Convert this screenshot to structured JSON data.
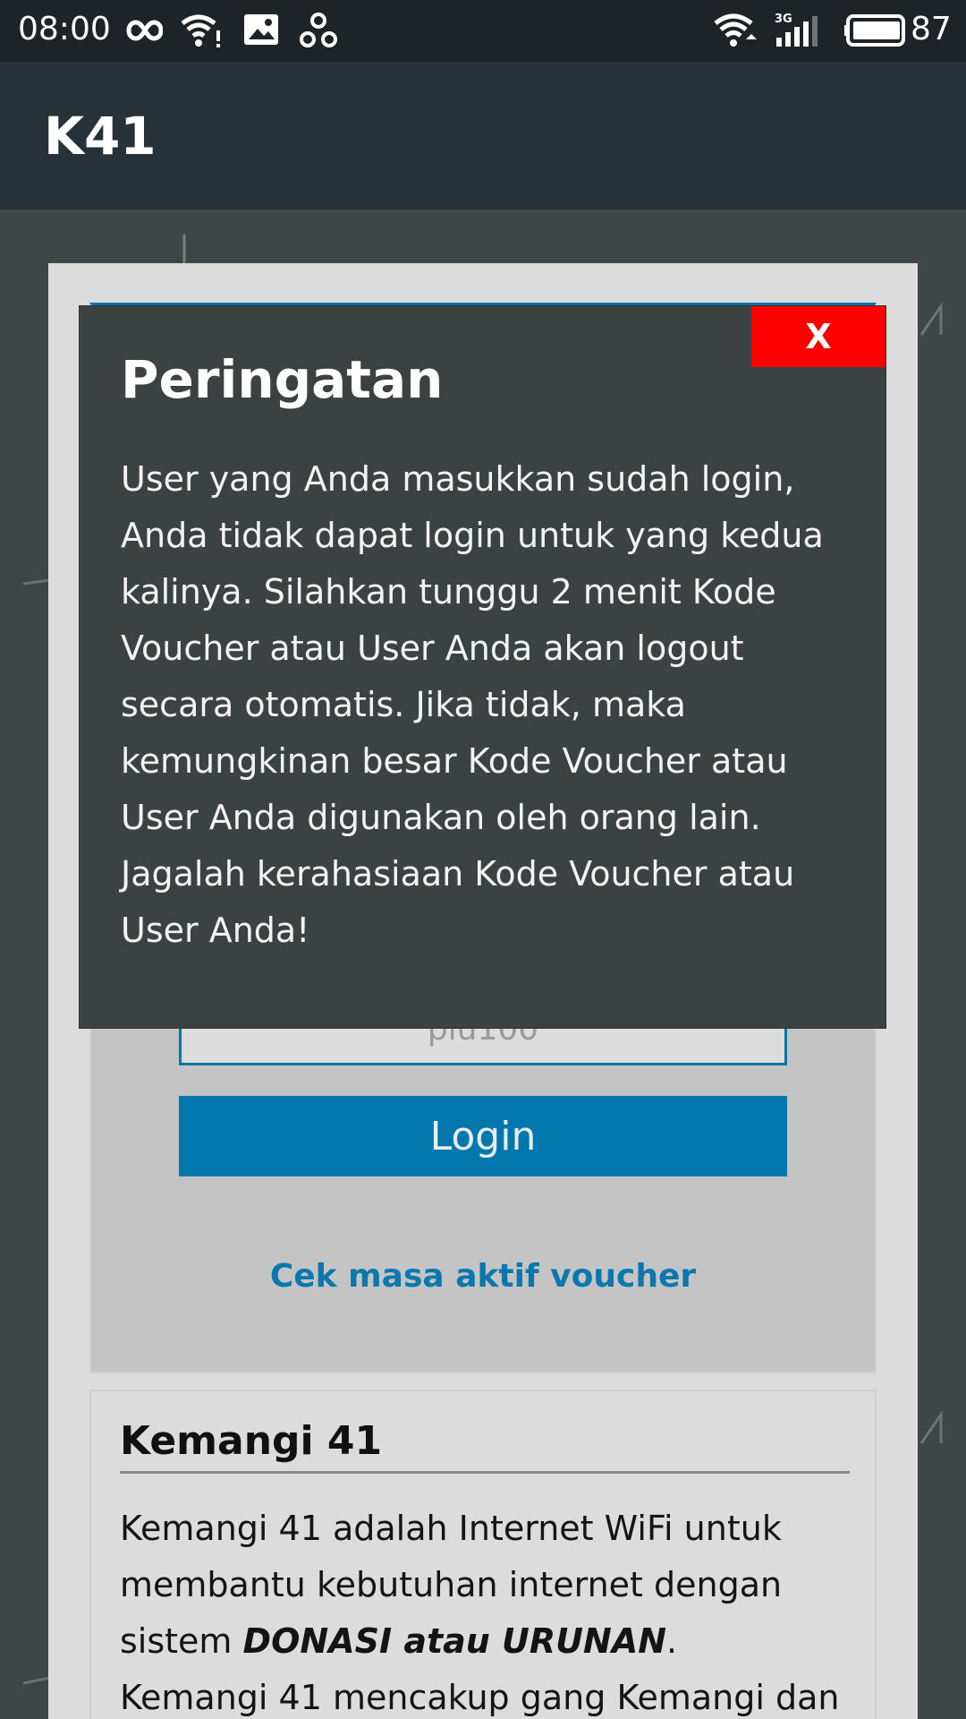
{
  "status_bar": {
    "time": "08:00",
    "battery": "87",
    "network_label": "3G",
    "icons": [
      "infinity-icon",
      "wifi-alert-icon",
      "image-icon",
      "link-icon",
      "wifi-icon",
      "signal-icon",
      "battery-icon"
    ]
  },
  "app_bar": {
    "title": "K41"
  },
  "login": {
    "password_value": "plu100",
    "login_button": "Login",
    "check_voucher_link": "Cek masa aktif voucher"
  },
  "info": {
    "title": "Kemangi 41",
    "text_part1": "Kemangi 41 adalah Internet WiFi untuk membantu kebutuhan internet dengan sistem ",
    "text_emphasis": "DONASI atau URUNAN",
    "text_part2": ".",
    "text_line2": "Kemangi 41 mencakup gang Kemangi dan"
  },
  "modal": {
    "close_label": "X",
    "title": "Peringatan",
    "message": "User yang Anda masukkan sudah login, Anda tidak dapat login untuk yang kedua kalinya. Silahkan tunggu 2 menit Kode Voucher atau User Anda akan logout secara otomatis. Jika tidak, maka kemungkinan besar Kode Voucher atau User Anda digunakan oleh orang lain. Jagalah kerahasiaan Kode Voucher atau User Anda!"
  },
  "colors": {
    "accent": "#0277ae",
    "close": "#ff0000",
    "app_bar": "#263238",
    "modal": "#3c4142"
  }
}
